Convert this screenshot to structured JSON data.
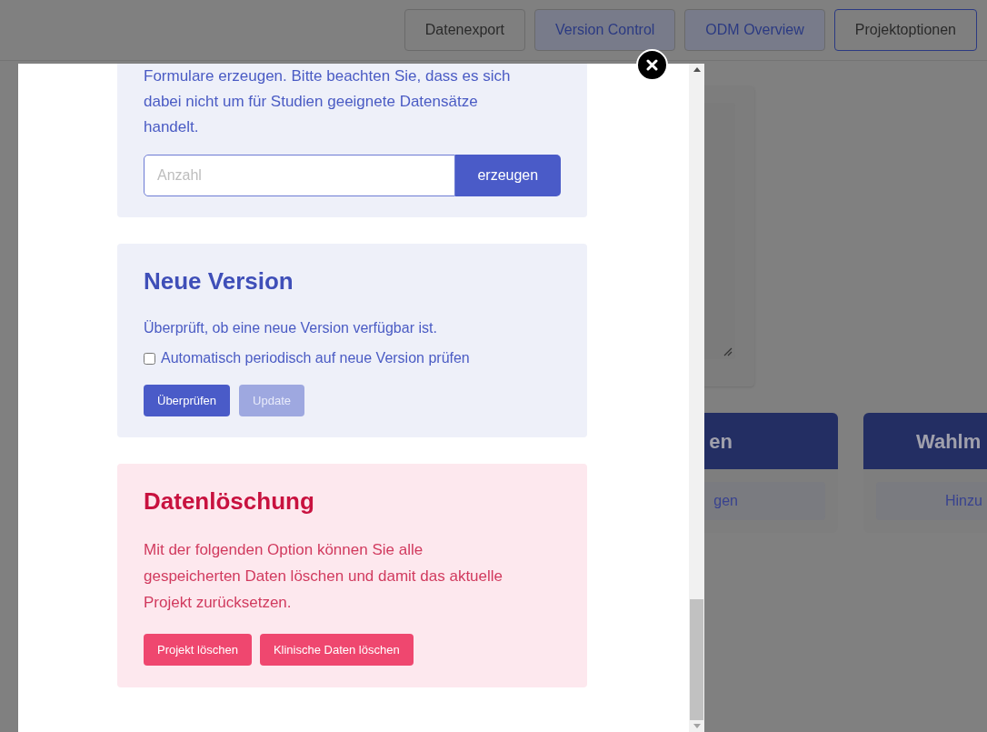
{
  "nav": {
    "buttons": [
      {
        "label": "Datenexport",
        "kind": "outline",
        "selected": false
      },
      {
        "label": "Version Control",
        "kind": "tinted",
        "selected": false
      },
      {
        "label": "ODM Overview",
        "kind": "tinted",
        "selected": false
      },
      {
        "label": "Projektoptionen",
        "kind": "outline",
        "selected": true
      }
    ]
  },
  "background": {
    "cards": [
      {
        "title": "en",
        "button": "gen"
      },
      {
        "title": "Wahlm",
        "button": "Hinzu"
      }
    ]
  },
  "modal": {
    "sections": [
      {
        "kind": "generate",
        "text": "Formulare erzeugen. Bitte beachten Sie, dass es sich dabei nicht um für Studien geeignete Datensätze handelt.",
        "input": {
          "placeholder": "Anzahl"
        },
        "button": "erzeugen"
      },
      {
        "kind": "version",
        "title": "Neue Version",
        "text": "Überprüft, ob eine neue Version verfügbar ist.",
        "checkbox": {
          "label": "Automatisch periodisch auf neue Version prüfen",
          "checked": false
        },
        "buttons": [
          {
            "label": "Überprüfen",
            "disabled": false
          },
          {
            "label": "Update",
            "disabled": true
          }
        ]
      },
      {
        "kind": "danger",
        "title": "Datenlöschung",
        "text": "Mit der folgenden Option können Sie alle gespeicherten Daten löschen und damit das aktuelle Projekt zurücksetzen.",
        "buttons": [
          {
            "label": "Projekt löschen",
            "disabled": false
          },
          {
            "label": "Klinische Daten löschen",
            "disabled": false
          }
        ]
      }
    ]
  }
}
